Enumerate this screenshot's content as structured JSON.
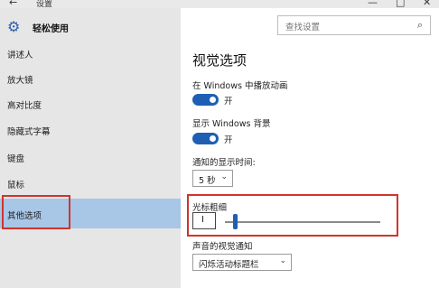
{
  "window": {
    "back_icon": "←",
    "title": "设置",
    "minimize": "—",
    "maximize": "□",
    "close": "✕"
  },
  "sidebar": {
    "section_icon": "gear-icon",
    "section_title": "轻松使用",
    "items": [
      {
        "label": "讲述人",
        "active": false
      },
      {
        "label": "放大镜",
        "active": false
      },
      {
        "label": "高对比度",
        "active": false
      },
      {
        "label": "隐藏式字幕",
        "active": false
      },
      {
        "label": "键盘",
        "active": false
      },
      {
        "label": "鼠标",
        "active": false
      },
      {
        "label": "其他选项",
        "active": true
      }
    ]
  },
  "search": {
    "placeholder": "查找设置",
    "icon": "search-icon"
  },
  "main": {
    "heading": "视觉选项",
    "animations": {
      "label": "在 Windows 中播放动画",
      "state": "开",
      "on": true
    },
    "background": {
      "label": "显示 Windows 背景",
      "state": "开",
      "on": true
    },
    "notification_time": {
      "label": "通知的显示时间:",
      "value": "5 秒"
    },
    "cursor_thickness": {
      "label": "光标粗细",
      "value": "I",
      "level": 0.06
    },
    "sound_visual": {
      "label": "声音的视觉通知",
      "value": "闪烁活动标题栏"
    }
  },
  "colors": {
    "accent": "#1e5fb4",
    "highlight_box": "#d0342c",
    "active_item": "#a8c6e6"
  }
}
